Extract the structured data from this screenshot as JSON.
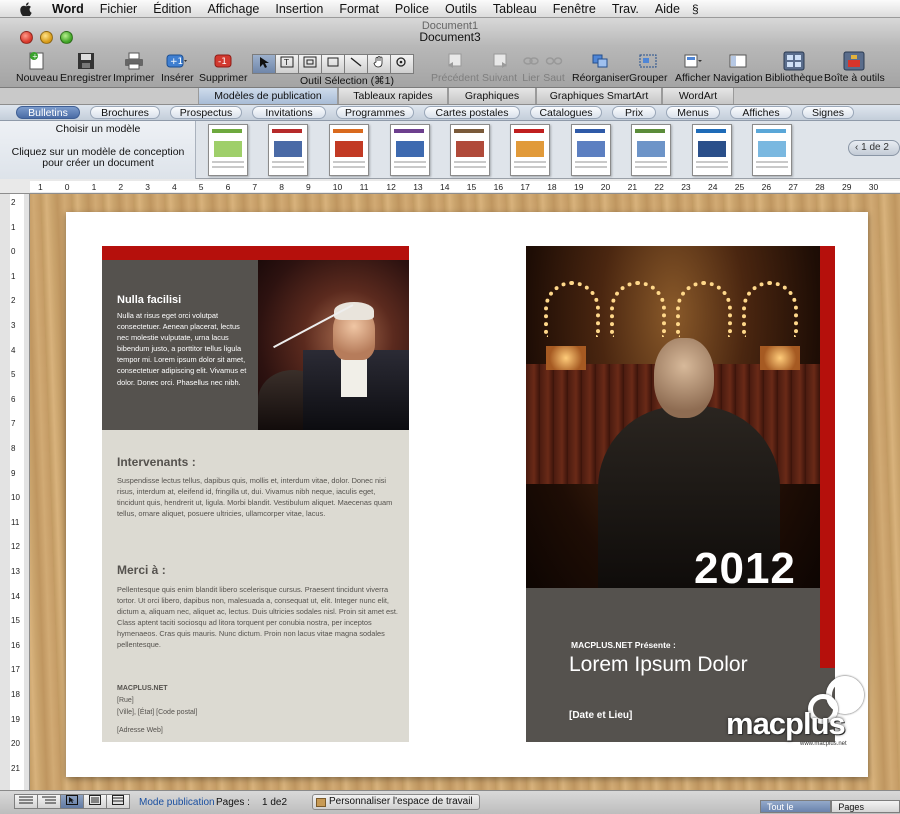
{
  "menubar": {
    "app": "Word",
    "items": [
      "Fichier",
      "Édition",
      "Affichage",
      "Insertion",
      "Format",
      "Police",
      "Outils",
      "Tableau",
      "Fenêtre",
      "Trav.",
      "Aide"
    ]
  },
  "window": {
    "title_back": "Document1",
    "title_front": "Document3"
  },
  "toolbar": {
    "nouveau": "Nouveau",
    "enregistrer": "Enregistrer",
    "imprimer": "Imprimer",
    "inserer": "Insérer",
    "supprimer": "Supprimer",
    "outil_selection": "Outil Sélection (⌘1)",
    "precedent": "Précédent",
    "suivant": "Suivant",
    "lier": "Lier",
    "saut": "Saut",
    "reorganiser": "Réorganiser",
    "grouper": "Grouper",
    "afficher": "Afficher",
    "navigation": "Navigation",
    "bibliotheque": "Bibliothèque",
    "boite_outils": "Boîte à outils"
  },
  "gallery_tabs": [
    "Modèles de publication",
    "Tableaux rapides",
    "Graphiques",
    "Graphiques SmartArt",
    "WordArt"
  ],
  "categories": [
    "Bulletins",
    "Brochures",
    "Prospectus",
    "Invitations",
    "Programmes",
    "Cartes postales",
    "Catalogues",
    "Prix",
    "Menus",
    "Affiches",
    "Signes"
  ],
  "template_panel": {
    "title": "Choisir un modèle",
    "hint": "Cliquez sur un modèle de conception pour créer un document",
    "pager": "1 de 2"
  },
  "ruler": {
    "h_ticks": [
      "1",
      "0",
      "1",
      "2",
      "3",
      "4",
      "5",
      "6",
      "7",
      "8",
      "9",
      "10",
      "11",
      "12",
      "13",
      "14",
      "15",
      "16",
      "17",
      "18",
      "19",
      "20",
      "21",
      "22",
      "23",
      "24",
      "25",
      "26",
      "27",
      "28",
      "29",
      "30"
    ],
    "v_ticks": [
      "2",
      "1",
      "0",
      "1",
      "2",
      "3",
      "4",
      "5",
      "6",
      "7",
      "8",
      "9",
      "10",
      "11",
      "12",
      "13",
      "14",
      "15",
      "16",
      "17",
      "18",
      "19",
      "20",
      "21"
    ]
  },
  "left_page": {
    "box_title": "Nulla facilisi",
    "box_body": "Nulla at risus eget orci volutpat consectetuer. Aenean placerat, lectus nec molestie vulputate, urna lacus bibendum justo, a porttitor tellus ligula tempor mi. Lorem ipsum dolor sit amet, consectetuer adipiscing elit. Vivamus et dolor. Donec orci. Phasellus nec nibh.",
    "h1": "Intervenants :",
    "p1": "Suspendisse lectus tellus, dapibus quis, mollis et, interdum vitae, dolor. Donec nisi risus, interdum at, eleifend id, fringilla ut, dui. Vivamus nibh neque, iaculis eget, tincidunt quis, hendrerit ut, ligula. Morbi blandit. Vestibulum aliquet. Maecenas quam tellus, ornare aliquet, posuere ultricies, ullamcorper vitae, lacus.",
    "h2": "Merci à :",
    "p2": "Pellentesque quis enim blandit libero scelerisque cursus. Praesent tincidunt viverra tortor. Ut orci libero, dapibus non, malesuada a, consequat ut, elit. Integer nunc elit, dictum a, aliquam nec, aliquet ac, lectus. Duis ultricies sodales nisl. Proin sit amet est. Class aptent taciti sociosqu ad litora torquent per conubia nostra, per inceptos hymenaeos. Cras quis mauris. Nunc dictum. Proin non lacus vitae magna sodales pellentesque.",
    "org": "MACPLUS.NET",
    "rue": "[Rue]",
    "ville": "[Ville], [État] [Code postal]",
    "web": "[Adresse Web]"
  },
  "right_page": {
    "year": "2012",
    "presente": "MACPLUS.NET Présente :",
    "title": "Lorem Ipsum Dolor",
    "date": "[Date et Lieu]"
  },
  "watermark": {
    "brand": "macplus",
    "url": "www.macplus.net"
  },
  "statusbar": {
    "mode": "Mode publication",
    "pages_label": "Pages :",
    "pages_value": "1 de2",
    "personnaliser": "Personnaliser l'espace de travail",
    "tab_contenu": "Tout le contenu",
    "tab_maitres": "Pages maîtres"
  },
  "colors": {
    "accent_red": "#b5100c",
    "panel_dark": "#55524e",
    "panel_light": "#dcdad2",
    "selected_blue": "#4a6ca5"
  }
}
